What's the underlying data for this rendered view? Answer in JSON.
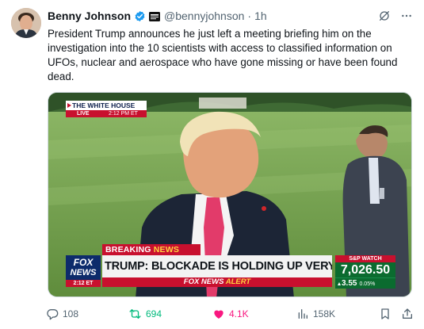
{
  "author": {
    "display_name": "Benny Johnson",
    "handle": "@bennyjohnson",
    "time": "1h"
  },
  "tweet": {
    "text": "President Trump announces he just left a meeting briefing him on the investigation into the 10 scientists with access to classified information on UFOs, nuclear and aerospace who have gone missing or have been found dead."
  },
  "media": {
    "white_house_bug": {
      "title": "THE WHITE HOUSE",
      "live": "LIVE",
      "clock": "2:12 PM ET"
    },
    "chyron": {
      "breaking": "BREAKING",
      "news": "NEWS",
      "headline": "TRUMP: BLOCKADE IS HOLDING UP VERY WELL",
      "alert_brand": "FOX NEWS",
      "alert_word": "ALERT"
    },
    "fox_logo": {
      "line1": "FOX",
      "line2": "NEWS",
      "clock": "2:12 ET"
    },
    "market": {
      "label": "S&P WATCH",
      "value": "7,026.50",
      "change": "3.55",
      "change_pct": "0.05%"
    }
  },
  "actions": {
    "replies": "108",
    "retweets": "694",
    "likes": "4.1K",
    "views": "158K"
  },
  "colors": {
    "accent_blue": "#1d9bf0",
    "retweet_green": "#00ba7c",
    "like_pink": "#f91880",
    "fox_red": "#c8102e",
    "fox_navy": "#0d2b6b",
    "market_green": "#0b6b2f"
  },
  "icons": [
    "verified-icon",
    "affiliate-badge-icon",
    "grok-icon",
    "more-icon",
    "reply-icon",
    "retweet-icon",
    "like-icon",
    "views-icon",
    "bookmark-icon",
    "share-icon"
  ]
}
